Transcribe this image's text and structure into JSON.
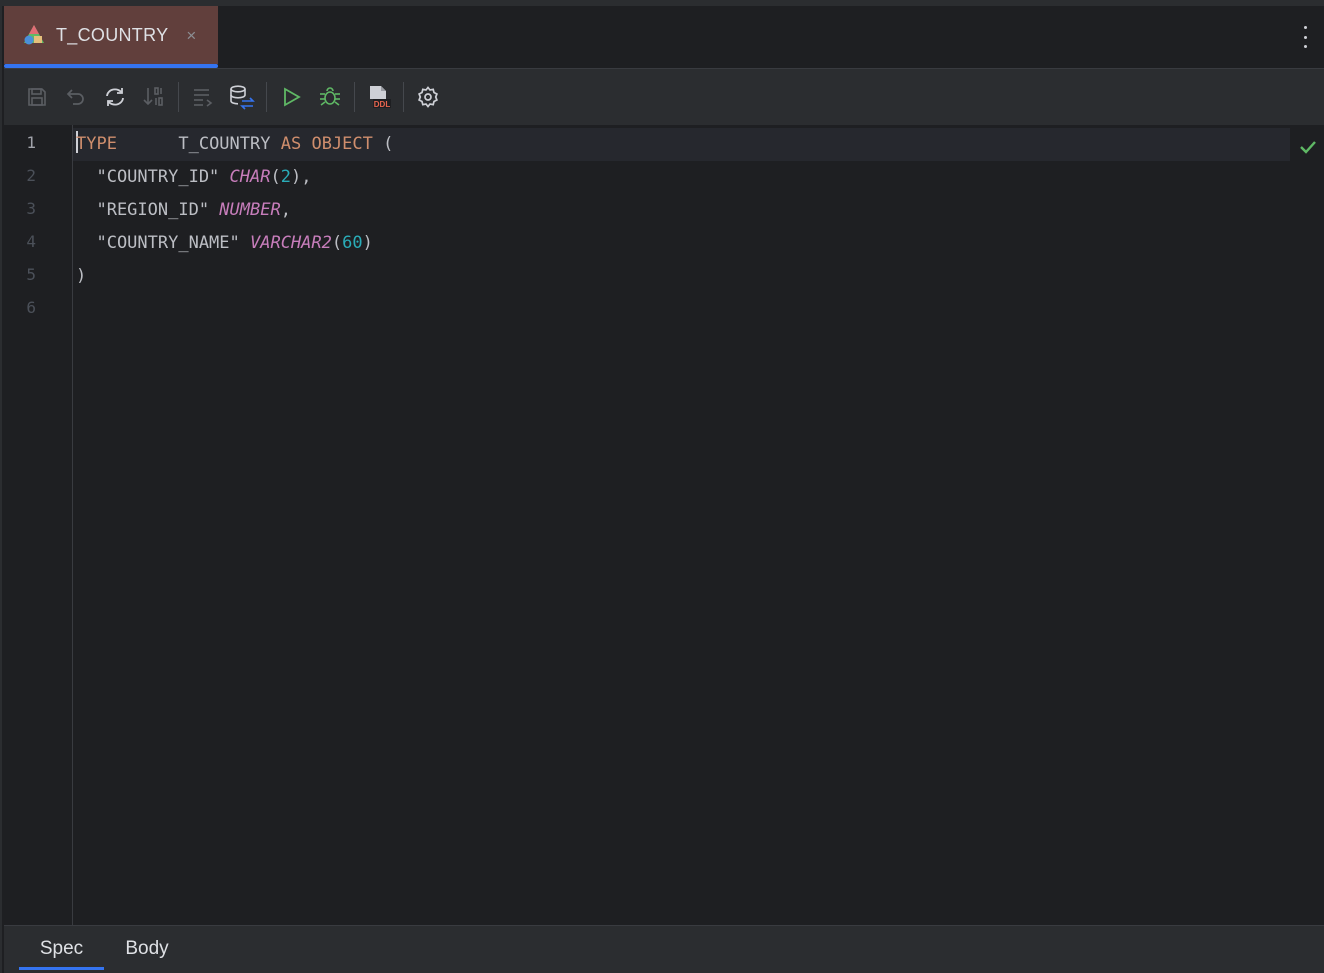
{
  "tab": {
    "label": "T_COUNTRY",
    "close": "×"
  },
  "colors": {
    "accent": "#3574f0",
    "tab_bg": "#613f3c",
    "keyword": "#cf8e6d",
    "type": "#c77dbb",
    "number": "#2aacb8",
    "ok": "#5fb865"
  },
  "toolbar": {
    "buttons": [
      "save-icon",
      "undo-icon",
      "refresh-icon",
      "sort-icon",
      "format-icon",
      "database-compare-icon",
      "run-icon",
      "debug-icon",
      "ddl-icon",
      "settings-icon"
    ]
  },
  "editor": {
    "line_numbers": [
      "1",
      "2",
      "3",
      "4",
      "5",
      "6"
    ],
    "lines": [
      {
        "parts": [
          {
            "t": "TYPE",
            "c": "kw"
          },
          {
            "t": "      T_COUNTRY "
          },
          {
            "t": "AS",
            "c": "kw"
          },
          {
            "t": " "
          },
          {
            "t": "OBJECT",
            "c": "kw"
          },
          {
            "t": " ("
          }
        ]
      },
      {
        "parts": [
          {
            "t": "  \"COUNTRY_ID\" "
          },
          {
            "t": "CHAR",
            "c": "ty"
          },
          {
            "t": "("
          },
          {
            "t": "2",
            "c": "num"
          },
          {
            "t": "),"
          }
        ]
      },
      {
        "parts": [
          {
            "t": "  \"REGION_ID\" "
          },
          {
            "t": "NUMBER",
            "c": "ty"
          },
          {
            "t": ","
          }
        ]
      },
      {
        "parts": [
          {
            "t": "  \"COUNTRY_NAME\" "
          },
          {
            "t": "VARCHAR2",
            "c": "ty"
          },
          {
            "t": "("
          },
          {
            "t": "60",
            "c": "num"
          },
          {
            "t": ")"
          }
        ]
      },
      {
        "parts": [
          {
            "t": ")"
          }
        ]
      },
      {
        "parts": []
      }
    ],
    "status": "check-icon"
  },
  "bottom_tabs": [
    {
      "label": "Spec",
      "active": true
    },
    {
      "label": "Body",
      "active": false
    }
  ]
}
